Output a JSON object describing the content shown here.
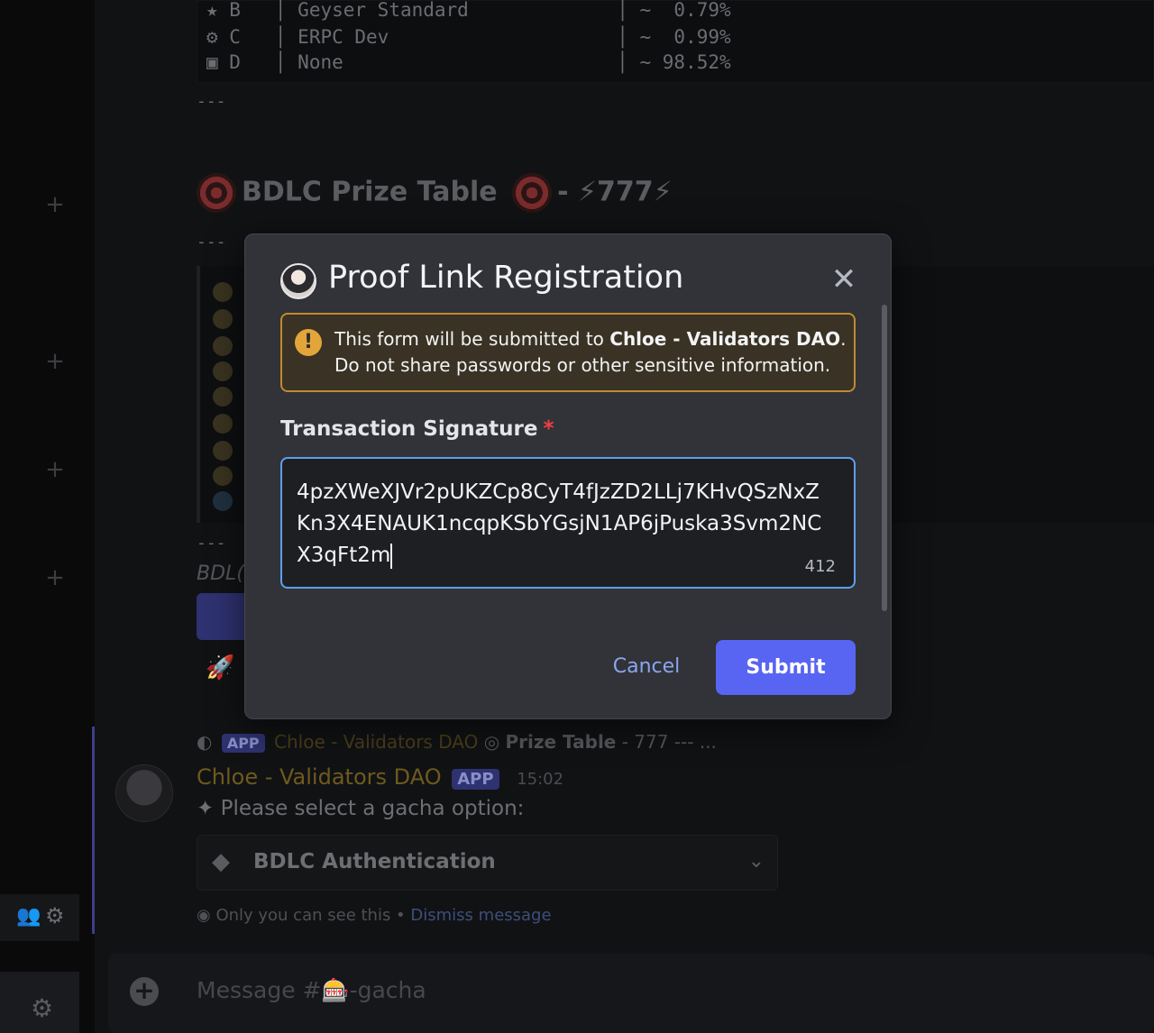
{
  "background": {
    "code_rows": [
      {
        "tier": "B",
        "name": "Geyser Standard",
        "odds": "~  0.79%"
      },
      {
        "tier": "C",
        "name": "ERPC Dev",
        "odds": "~  0.99%"
      },
      {
        "tier": "D",
        "name": "None",
        "odds": "~ 98.52%"
      }
    ],
    "divider": "---",
    "heading": "BDLC Prize Table",
    "heading_suffix": "- ⚡777⚡",
    "bdlc_fragment": "BDL(",
    "reply_preview": {
      "author": "Chloe - Validators DAO",
      "app_tag": "APP",
      "text": "Prize Table",
      "suffix": "- 777    --- ..."
    },
    "message": {
      "author": "Chloe - Validators DAO",
      "app_tag": "APP",
      "time": "15:02",
      "body": "Please select a gacha option:",
      "select_value": "BDLC Authentication",
      "ephemeral_note": "Only you can see this •",
      "dismiss_link": "Dismiss message"
    },
    "composer_placeholder": "Message #🎰-gacha"
  },
  "modal": {
    "title": "Proof Link Registration",
    "warning": {
      "prefix": "This form will be submitted to ",
      "bold": "Chloe - Validators DAO",
      "suffix": ". Do not share passwords or other sensitive information."
    },
    "field": {
      "label": "Transaction Signature",
      "required_mark": "*",
      "value": "4pzXWeXJVr2pUKZCp8CyT4fJzZD2LLj7KHvQSzNxZKn3X4ENAUK1ncqpKSbYGsjN1AP6jPuska3Svm2NCX3qFt2m",
      "char_count": "412"
    },
    "cancel_label": "Cancel",
    "submit_label": "Submit"
  },
  "colors": {
    "accent": "#5865f2",
    "focus_border": "#5f9fe8",
    "warning_border": "#c08a2e",
    "required": "#f23f42"
  }
}
